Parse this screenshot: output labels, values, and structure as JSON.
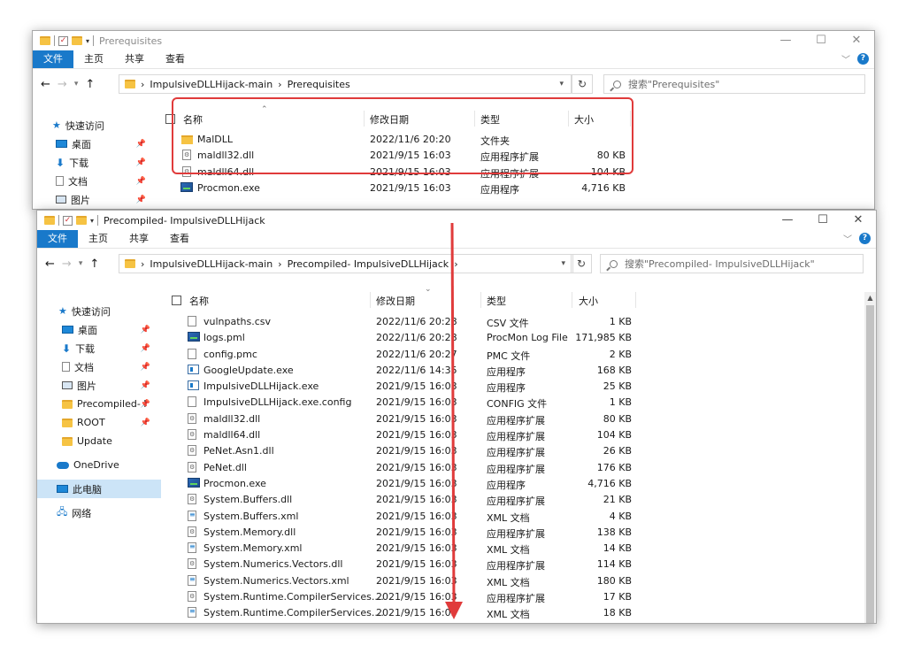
{
  "ribbon": {
    "file": "文件",
    "home": "主页",
    "share": "共享",
    "view": "查看"
  },
  "window_top": {
    "title": "Prerequisites",
    "breadcrumb": [
      "ImpulsiveDLLHijack-main",
      "Prerequisites"
    ],
    "search_placeholder": "搜索\"Prerequisites\"",
    "nav": [
      {
        "label": "快速访问"
      },
      {
        "label": "桌面"
      },
      {
        "label": "下载"
      },
      {
        "label": "文档"
      },
      {
        "label": "图片"
      }
    ],
    "columns": {
      "name": "名称",
      "date": "修改日期",
      "type": "类型",
      "size": "大小"
    },
    "files": [
      {
        "icon": "folder-icon",
        "name": "MalDLL",
        "date": "2022/11/6 20:20",
        "type": "文件夹",
        "size": ""
      },
      {
        "icon": "dll-file-icon",
        "name": "maldll32.dll",
        "date": "2021/9/15 16:03",
        "type": "应用程序扩展",
        "size": "80 KB"
      },
      {
        "icon": "dll-file-icon",
        "name": "maldll64.dll",
        "date": "2021/9/15 16:03",
        "type": "应用程序扩展",
        "size": "104 KB"
      },
      {
        "icon": "procmon-icon",
        "name": "Procmon.exe",
        "date": "2021/9/15 16:03",
        "type": "应用程序",
        "size": "4,716 KB"
      }
    ]
  },
  "window_bottom": {
    "title": "Precompiled- ImpulsiveDLLHijack",
    "breadcrumb": [
      "ImpulsiveDLLHijack-main",
      "Precompiled- ImpulsiveDLLHijack"
    ],
    "search_placeholder": "搜索\"Precompiled- ImpulsiveDLLHijack\"",
    "nav": [
      {
        "label": "快速访问"
      },
      {
        "label": "桌面"
      },
      {
        "label": "下载"
      },
      {
        "label": "文档"
      },
      {
        "label": "图片"
      },
      {
        "label": "Precompiled- I"
      },
      {
        "label": "ROOT"
      },
      {
        "label": "Update"
      },
      {
        "label": "OneDrive"
      },
      {
        "label": "此电脑"
      },
      {
        "label": "网络"
      }
    ],
    "columns": {
      "name": "名称",
      "date": "修改日期",
      "type": "类型",
      "size": "大小"
    },
    "files": [
      {
        "icon": "file-icon",
        "name": "vulnpaths.csv",
        "date": "2022/11/6 20:28",
        "type": "CSV 文件",
        "size": "1 KB"
      },
      {
        "icon": "procmon-log-icon",
        "name": "logs.pml",
        "date": "2022/11/6 20:28",
        "type": "ProcMon Log File",
        "size": "171,985 KB"
      },
      {
        "icon": "file-icon",
        "name": "config.pmc",
        "date": "2022/11/6 20:27",
        "type": "PMC 文件",
        "size": "2 KB"
      },
      {
        "icon": "google-update-icon",
        "name": "GoogleUpdate.exe",
        "date": "2022/11/6 14:35",
        "type": "应用程序",
        "size": "168 KB"
      },
      {
        "icon": "app-icon",
        "name": "ImpulsiveDLLHijack.exe",
        "date": "2021/9/15 16:03",
        "type": "应用程序",
        "size": "25 KB"
      },
      {
        "icon": "file-icon",
        "name": "ImpulsiveDLLHijack.exe.config",
        "date": "2021/9/15 16:03",
        "type": "CONFIG 文件",
        "size": "1 KB"
      },
      {
        "icon": "dll-file-icon",
        "name": "maldll32.dll",
        "date": "2021/9/15 16:03",
        "type": "应用程序扩展",
        "size": "80 KB"
      },
      {
        "icon": "dll-file-icon",
        "name": "maldll64.dll",
        "date": "2021/9/15 16:03",
        "type": "应用程序扩展",
        "size": "104 KB"
      },
      {
        "icon": "dll-file-icon",
        "name": "PeNet.Asn1.dll",
        "date": "2021/9/15 16:03",
        "type": "应用程序扩展",
        "size": "26 KB"
      },
      {
        "icon": "dll-file-icon",
        "name": "PeNet.dll",
        "date": "2021/9/15 16:03",
        "type": "应用程序扩展",
        "size": "176 KB"
      },
      {
        "icon": "procmon-icon",
        "name": "Procmon.exe",
        "date": "2021/9/15 16:03",
        "type": "应用程序",
        "size": "4,716 KB"
      },
      {
        "icon": "dll-file-icon",
        "name": "System.Buffers.dll",
        "date": "2021/9/15 16:03",
        "type": "应用程序扩展",
        "size": "21 KB"
      },
      {
        "icon": "xml-file-icon",
        "name": "System.Buffers.xml",
        "date": "2021/9/15 16:03",
        "type": "XML 文档",
        "size": "4 KB"
      },
      {
        "icon": "dll-file-icon",
        "name": "System.Memory.dll",
        "date": "2021/9/15 16:03",
        "type": "应用程序扩展",
        "size": "138 KB"
      },
      {
        "icon": "xml-file-icon",
        "name": "System.Memory.xml",
        "date": "2021/9/15 16:03",
        "type": "XML 文档",
        "size": "14 KB"
      },
      {
        "icon": "dll-file-icon",
        "name": "System.Numerics.Vectors.dll",
        "date": "2021/9/15 16:03",
        "type": "应用程序扩展",
        "size": "114 KB"
      },
      {
        "icon": "xml-file-icon",
        "name": "System.Numerics.Vectors.xml",
        "date": "2021/9/15 16:03",
        "type": "XML 文档",
        "size": "180 KB"
      },
      {
        "icon": "dll-file-icon",
        "name": "System.Runtime.CompilerServices....",
        "date": "2021/9/15 16:03",
        "type": "应用程序扩展",
        "size": "17 KB"
      },
      {
        "icon": "xml-file-icon",
        "name": "System.Runtime.CompilerServices....",
        "date": "2021/9/15 16:03",
        "type": "XML 文档",
        "size": "18 KB"
      }
    ]
  },
  "colors": {
    "accent": "#1979ca",
    "highlight": "#e03b3b",
    "folder": "#f6c343",
    "selected": "#cce4f7"
  }
}
